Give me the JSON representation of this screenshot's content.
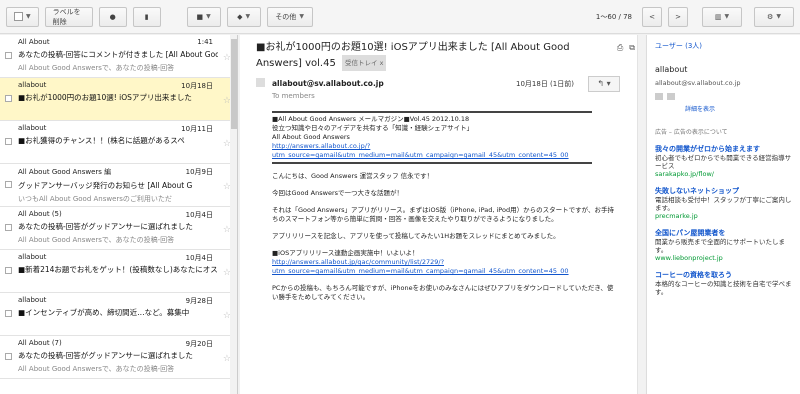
{
  "toolbar": {
    "labels_button": "ラベルを削除",
    "more_button": "その他",
    "pager": "1～60 / 78"
  },
  "messages": [
    {
      "from": "All About",
      "date": "1:41",
      "subject": "あなたの投稿-回答にコメントが付きました [All About Goo",
      "snippet": "All About Good Answersで、あなたの投稿-回答",
      "selected": false
    },
    {
      "from": "allabout",
      "date": "10月18日",
      "subject": "■お礼が1000円のお題10選! iOSアプリ出来ました",
      "snippet": "",
      "selected": true
    },
    {
      "from": "allabout",
      "date": "10月11日",
      "subject": "■お礼獲得のチャンス！！(株名に話題があるスペ",
      "snippet": "",
      "selected": false
    },
    {
      "from": "All About Good Answers 編",
      "date": "10月9日",
      "subject": "グッドアンサーバッジ発行のお知らせ [All About G",
      "snippet": "いつもAll About Good Answersのご利用いただ",
      "selected": false
    },
    {
      "from": "All About (5)",
      "date": "10月4日",
      "subject": "あなたの投稿-回答がグッドアンサーに選ばれました",
      "snippet": "All About Good Answersで、あなたの投稿-回答",
      "selected": false
    },
    {
      "from": "allabout",
      "date": "10月4日",
      "subject": "■新着214お題でお礼をゲット！(投稿数なし)あなたにオス",
      "snippet": "",
      "selected": false
    },
    {
      "from": "allabout",
      "date": "9月28日",
      "subject": "■インセンティブが高め、締切間近…など。募集中",
      "snippet": "",
      "selected": false
    },
    {
      "from": "All About (7)",
      "date": "9月20日",
      "subject": "あなたの投稿-回答がグッドアンサーに選ばれました",
      "snippet": "All About Good Answersで、あなたの投稿-回答",
      "selected": false
    }
  ],
  "message": {
    "subject": "■お礼が1000円のお題10選! iOSアプリ出来ました [All About Good Answers] vol.45",
    "label_chip": "受信トレイ x",
    "sender": "allabout@sv.allabout.co.jp",
    "to": "To members",
    "date": "10月18日 (1日前)",
    "header_line1": "■All About Good Answers メールマガジン■Vol.45 2012.10.18",
    "header_line2": "役立つ知識や日々のアイデアを共有する「知識・経験シェアサイト」",
    "header_line3": "All About Good Answers",
    "link1": "http://answers.allabout.co.jp/?utm_source=gamail&utm_medium=mail&utm_campaign=gamail_45&utm_content=45_00",
    "greeting": "こんにちは、Good Answers 運営スタッフ 信永です！",
    "para1": "今回はGood Answersで一つ大きな話題が！",
    "para2": "それは「Good Answers」アプリがリリース。まずはiOS版（iPhone, iPad, iPod用）からのスタートですが、お手持ちのスマートフォン等から簡単に質問・回答・画像を交えたやり取りができるようになりました。",
    "para3": "アプリリリースを記念し、アプリを使って投稿してみたい1Hお題をスレッドにまとめてみました。",
    "para4": "■iOSアプリリリース連動企画実施中！いよいよ！",
    "link2": "http://answers.allabout.jp/gac/community/list/2729/?utm_source=gamail&utm_medium=mail&utm_campaign=gamail_45&utm_content=45_00",
    "para5": "PCからの投稿も、もちろん可能ですが、iPhoneをお使いのみなさんにはぜひアプリをダウンロードしていただき、使い勝手をためしてみてください。"
  },
  "sidebar": {
    "title": "ユーザー (3人)",
    "contact_name": "allabout",
    "contact_email": "allabout@sv.allabout.co.jp",
    "details_link": "詳細を表示",
    "ads_header": "広告 – 広告の表示について",
    "ads": [
      {
        "title": "我々の開業がゼロから始まえます",
        "text": "初心者でもゼロからでも開業できる経営指導サービス",
        "url": "sarakapko.jp/flow/"
      },
      {
        "title": "失敗しないネットショップ",
        "text": "電話相談も受付中！スタッフが丁寧にご案内します。",
        "url": "precmarke.jp"
      },
      {
        "title": "全国にパン屋開業者を",
        "text": "開業から販売まで全面的にサポートいたします。",
        "url": "www.liebonproject.jp"
      },
      {
        "title": "コーヒーの資格を取ろう",
        "text": "本格的なコーヒーの知識と技術を自宅で学べます。",
        "url": ""
      }
    ]
  }
}
